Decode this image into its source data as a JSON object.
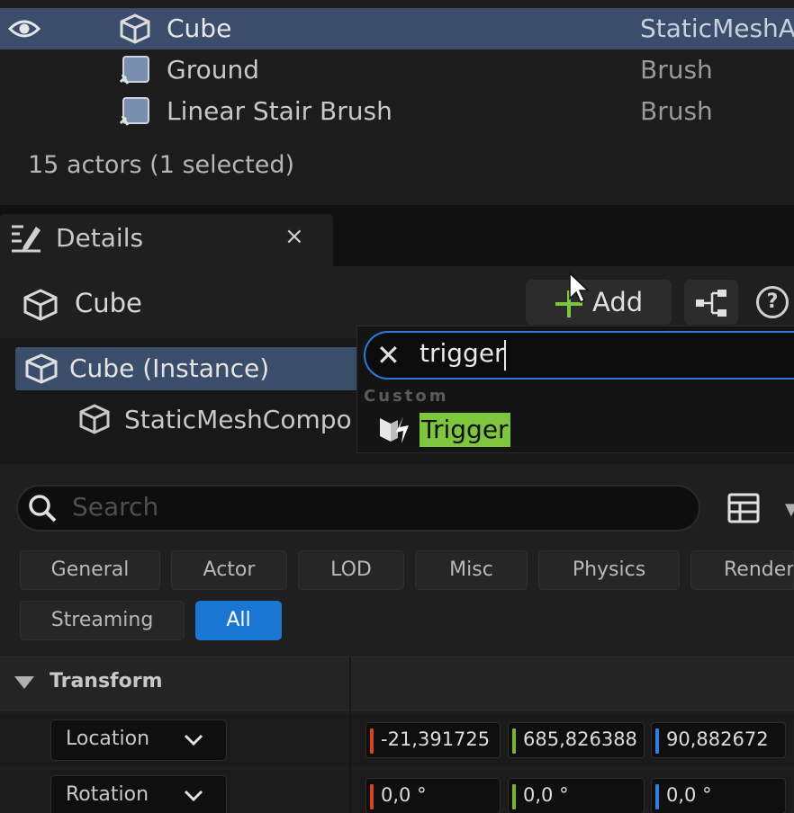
{
  "outliner": {
    "rows": [
      {
        "name": "Cube",
        "type": "StaticMeshA",
        "selected": true
      },
      {
        "name": "Ground",
        "type": "Brush",
        "selected": false
      },
      {
        "name": "Linear Stair Brush",
        "type": "Brush",
        "selected": false
      }
    ],
    "actor_count": "15 actors (1 selected)"
  },
  "details": {
    "tab_label": "Details",
    "close_glyph": "×",
    "actor_name": "Cube",
    "add_label": "Add",
    "help_glyph": "?",
    "component_root": "Cube (Instance)",
    "component_child": "StaticMeshCompo"
  },
  "add_dropdown": {
    "clear_glyph": "✕",
    "search_value": "trigger",
    "category": "Custom",
    "item": "Trigger"
  },
  "search": {
    "placeholder": "Search"
  },
  "filters": {
    "chips": [
      {
        "label": "General",
        "active": false
      },
      {
        "label": "Actor",
        "active": false
      },
      {
        "label": "LOD",
        "active": false
      },
      {
        "label": "Misc",
        "active": false
      },
      {
        "label": "Physics",
        "active": false
      },
      {
        "label": "Renderi",
        "active": false
      },
      {
        "label": "Streaming",
        "active": false
      },
      {
        "label": "All",
        "active": true
      }
    ]
  },
  "transform": {
    "header": "Transform",
    "location": {
      "label": "Location",
      "x": "-21,391725",
      "y": "685,826388",
      "z": "90,882672"
    },
    "rotation": {
      "label": "Rotation",
      "x": "0,0 °",
      "y": "0,0 °",
      "z": "0,0 °"
    }
  },
  "colors": {
    "selection": "#3a4d6b",
    "accent_blue": "#1976d2",
    "add_green": "#7fc63f",
    "axis_x": "#d9431f",
    "axis_y": "#7fb030",
    "axis_z": "#2f7fe0"
  },
  "icons": [
    "eye-icon",
    "static-mesh-icon",
    "brush-icon",
    "details-icon",
    "plus-icon",
    "blueprint-icon",
    "help-icon",
    "search-icon",
    "grid-icon",
    "trigger-icon",
    "chevron-down-icon",
    "collapse-arrow-icon"
  ]
}
